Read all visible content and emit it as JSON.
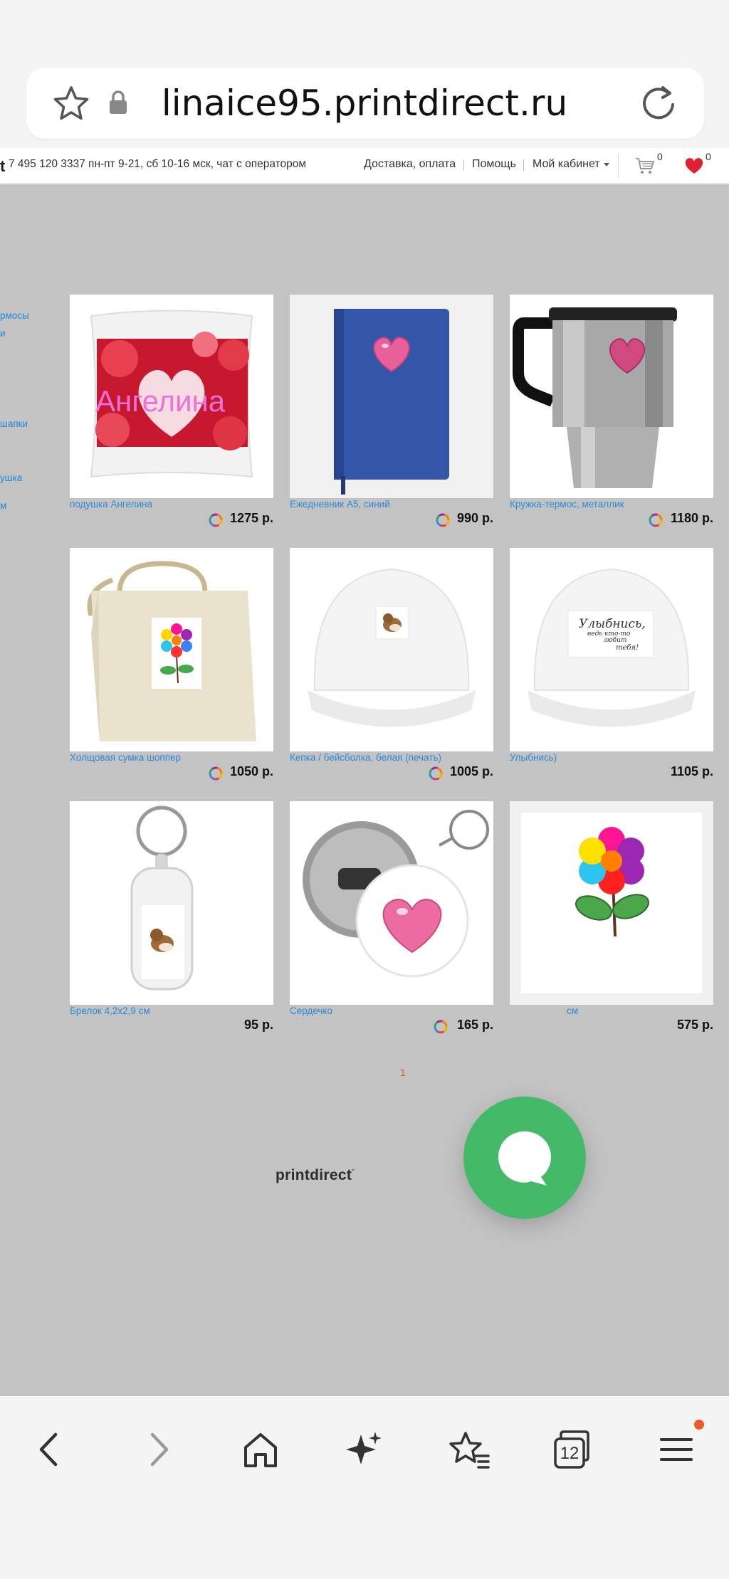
{
  "browser": {
    "url": "linaice95.printdirect.ru",
    "tabs_count": "12"
  },
  "header": {
    "logo_fragment": "t",
    "phone_info": "7 495 120 3337 пн-пт 9-21, сб 10-16 мск, чат с оператором",
    "nav": {
      "delivery": "Доставка, оплата",
      "help": "Помощь",
      "cabinet": "Мой кабинет"
    },
    "cart_count": "0",
    "favorites_count": "0"
  },
  "sidebar_fragments": [
    "рмосы",
    "и",
    "шапки",
    "ушка",
    "м"
  ],
  "products": [
    {
      "name": "подушка Ангелина",
      "price": "1275 р.",
      "rainbow": true,
      "image_text": "Ангелина"
    },
    {
      "name": "Ежедневник A5, синий",
      "price": "990 р.",
      "rainbow": true
    },
    {
      "name": "Кружка-термос, металлик",
      "price": "1180 р.",
      "rainbow": true
    },
    {
      "name": "Холщовая сумка шоппер",
      "price": "1050 р.",
      "rainbow": true
    },
    {
      "name": "Кепка / бейсболка, белая (печать)",
      "price": "1005 р.",
      "rainbow": true
    },
    {
      "name": "Улыбнись)",
      "price": "1105 р.",
      "rainbow": false,
      "image_text": [
        "Улыбнись,",
        "ведь кто-то",
        "любит",
        "тебя!"
      ]
    },
    {
      "name": "Брелок 4,2x2,9 см",
      "price": "95 р.",
      "rainbow": false
    },
    {
      "name": "Сердечко",
      "price": "165 р.",
      "rainbow": true
    },
    {
      "name": "см",
      "price": "575 р.",
      "rainbow": false
    }
  ],
  "pagination": {
    "current": "1"
  },
  "footer": {
    "logo": "printdirect",
    "logo_mark": "\""
  },
  "colors": {
    "accent_link": "#2a8ad8",
    "content_bg": "#c3c3c3",
    "chat_green": "#45b96a",
    "heart_red": "#e02030",
    "page_orange": "#e06010"
  }
}
